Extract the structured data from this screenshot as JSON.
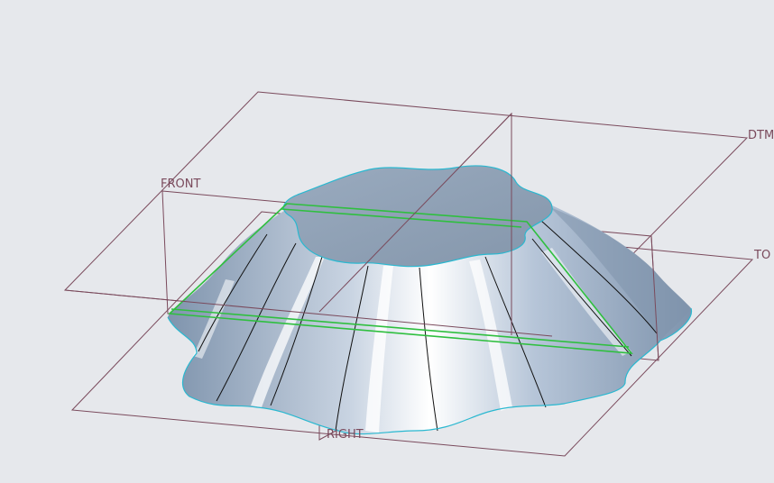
{
  "viewport": {
    "background": "#e6e8ec",
    "datum_planes": [
      {
        "id": "front",
        "label": "FRONT"
      },
      {
        "id": "dtm",
        "label": "DTM"
      },
      {
        "id": "top",
        "label": "TO"
      },
      {
        "id": "right",
        "label": "RIGHT"
      }
    ],
    "colors": {
      "datum_plane": "#7a4a5c",
      "silhouette": "#2ab8d0",
      "sketch": "#2fbf3f",
      "surface_light": "#ffffff",
      "surface_mid": "#b6c5d8",
      "surface_dark": "#7f94ad",
      "top_face": "#8e9fb3"
    }
  }
}
